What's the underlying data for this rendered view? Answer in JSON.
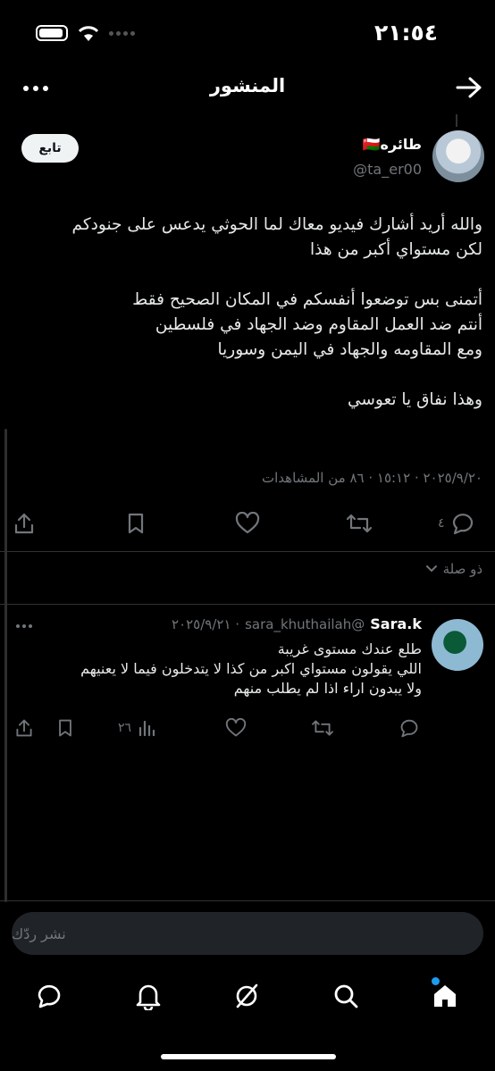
{
  "status_bar": {
    "time": "٢١:٥٤"
  },
  "header": {
    "title": "المنشور"
  },
  "post": {
    "author_name": "طائره🇴🇲",
    "author_handle": "@ta_er00",
    "follow_label": "تابع",
    "body": "والله أريد أشارك فيديو معاك لما الحوثي يدعس على جنودكم\nلكن مستواي أكبر من هذا\n\nأتمنى بس توضعوا أنفسكم في المكان الصحيح فقط\nأنتم ضد العمل المقاوم وضد الجهاد في فلسطين\nومع المقاومه والجهاد في اليمن وسوريا\n\nوهذا نفاق يا تعوسي",
    "meta": "٢٠٢٥/٩/٢٠ · ١٥:١٢ · ٨٦ من المشاهدات",
    "reply_count": "٤"
  },
  "related_label": "ذو صلة",
  "reply": {
    "name": "Sara.k",
    "handle": "@sara_khuthailah",
    "date": "· ٢٠٢٥/٩/٢١",
    "body": "طلع عندك مستوى غريبة\nاللي يقولون مستواي اكبر من كذا لا يتدخلون فيما لا يعنيهم\nولا يبدون اراء اذا لم يطلب منهم",
    "views": "٢٦"
  },
  "reply_input": {
    "placeholder": "نشر ردّك"
  },
  "colors": {
    "background": "#000000",
    "muted": "#71767b",
    "accent": "#1d9bf0",
    "divider": "#2f3336"
  }
}
